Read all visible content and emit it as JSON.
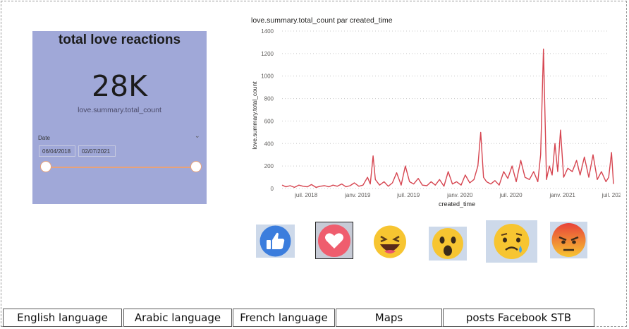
{
  "card": {
    "title": "total love reactions",
    "kpi_value": "28K",
    "kpi_label": "love.summary.total_count"
  },
  "slicer": {
    "title": "Date",
    "start_date": "06/04/2018",
    "end_date": "02/07/2021",
    "range_start_fraction": 0,
    "range_end_fraction": 1
  },
  "chart": {
    "title": "love.summary.total_count par created_time"
  },
  "chart_data": {
    "type": "line",
    "title": "love.summary.total_count par created_time",
    "xlabel": "created_time",
    "ylabel": "love.summary.total_count",
    "ylim": [
      0,
      1400
    ],
    "xlim": [
      "2018-04-06",
      "2021-07-02"
    ],
    "y_ticks": [
      "0",
      "200",
      "400",
      "600",
      "800",
      "1000",
      "1200",
      "1400"
    ],
    "x_ticks": [
      {
        "date": "2018-07-01",
        "label": "juil. 2018"
      },
      {
        "date": "2019-01-01",
        "label": "janv. 2019"
      },
      {
        "date": "2019-07-01",
        "label": "juil. 2019"
      },
      {
        "date": "2020-01-01",
        "label": "janv. 2020"
      },
      {
        "date": "2020-07-01",
        "label": "juil. 2020"
      },
      {
        "date": "2021-01-01",
        "label": "janv. 2021"
      },
      {
        "date": "2021-07-01",
        "label": "juil. 2021"
      }
    ],
    "grid": true,
    "color": "#d64550",
    "series": [
      {
        "x": [
          "2018-04-06",
          "2018-04-20",
          "2018-05-05",
          "2018-05-20",
          "2018-06-05",
          "2018-06-20",
          "2018-07-05",
          "2018-07-20",
          "2018-08-05",
          "2018-08-20",
          "2018-09-05",
          "2018-09-20",
          "2018-10-05",
          "2018-10-20",
          "2018-11-05",
          "2018-11-20",
          "2018-12-05",
          "2018-12-20",
          "2019-01-05",
          "2019-01-20",
          "2019-02-05",
          "2019-02-15",
          "2019-02-25",
          "2019-03-05",
          "2019-03-20",
          "2019-04-05",
          "2019-04-20",
          "2019-05-05",
          "2019-05-20",
          "2019-06-05",
          "2019-06-20",
          "2019-07-05",
          "2019-07-20",
          "2019-08-05",
          "2019-08-20",
          "2019-09-05",
          "2019-09-20",
          "2019-10-05",
          "2019-10-20",
          "2019-11-05",
          "2019-11-20",
          "2019-12-05",
          "2019-12-20",
          "2020-01-05",
          "2020-01-20",
          "2020-02-05",
          "2020-02-20",
          "2020-03-05",
          "2020-03-15",
          "2020-03-25",
          "2020-04-05",
          "2020-04-20",
          "2020-05-05",
          "2020-05-20",
          "2020-06-05",
          "2020-06-20",
          "2020-07-05",
          "2020-07-20",
          "2020-08-05",
          "2020-08-20",
          "2020-09-05",
          "2020-09-20",
          "2020-10-05",
          "2020-10-15",
          "2020-10-25",
          "2020-11-05",
          "2020-11-15",
          "2020-11-25",
          "2020-12-05",
          "2020-12-15",
          "2020-12-25",
          "2021-01-05",
          "2021-01-20",
          "2021-02-05",
          "2021-02-20",
          "2021-03-05",
          "2021-03-20",
          "2021-04-05",
          "2021-04-20",
          "2021-05-05",
          "2021-05-20",
          "2021-06-05",
          "2021-06-15",
          "2021-06-25",
          "2021-07-02"
        ],
        "values": [
          30,
          15,
          25,
          10,
          30,
          20,
          15,
          35,
          10,
          20,
          25,
          15,
          30,
          20,
          40,
          15,
          25,
          50,
          20,
          30,
          100,
          40,
          290,
          80,
          30,
          60,
          20,
          50,
          140,
          30,
          200,
          60,
          40,
          90,
          30,
          25,
          60,
          30,
          80,
          20,
          150,
          40,
          60,
          30,
          120,
          50,
          80,
          200,
          500,
          100,
          60,
          40,
          70,
          30,
          150,
          90,
          200,
          60,
          250,
          100,
          80,
          150,
          60,
          300,
          1240,
          80,
          200,
          120,
          400,
          150,
          520,
          100,
          180,
          150,
          250,
          120,
          280,
          100,
          300,
          80,
          150,
          60,
          100,
          320,
          40
        ]
      }
    ]
  },
  "reactions": [
    {
      "name": "like",
      "bg": "#cdd9ea",
      "selected": false
    },
    {
      "name": "love",
      "bg": "#c7cbd6",
      "selected": true
    },
    {
      "name": "haha",
      "bg": "#ffffff",
      "selected": false
    },
    {
      "name": "wow",
      "bg": "#cdd9ea",
      "selected": false
    },
    {
      "name": "sad",
      "bg": "#cdd9ea",
      "selected": false
    },
    {
      "name": "angry",
      "bg": "#cdd9ea",
      "selected": false
    }
  ],
  "nav": {
    "english": "English language",
    "arabic": "Arabic language",
    "french": "French language",
    "maps": "Maps",
    "posts": "posts Facebook STB"
  }
}
